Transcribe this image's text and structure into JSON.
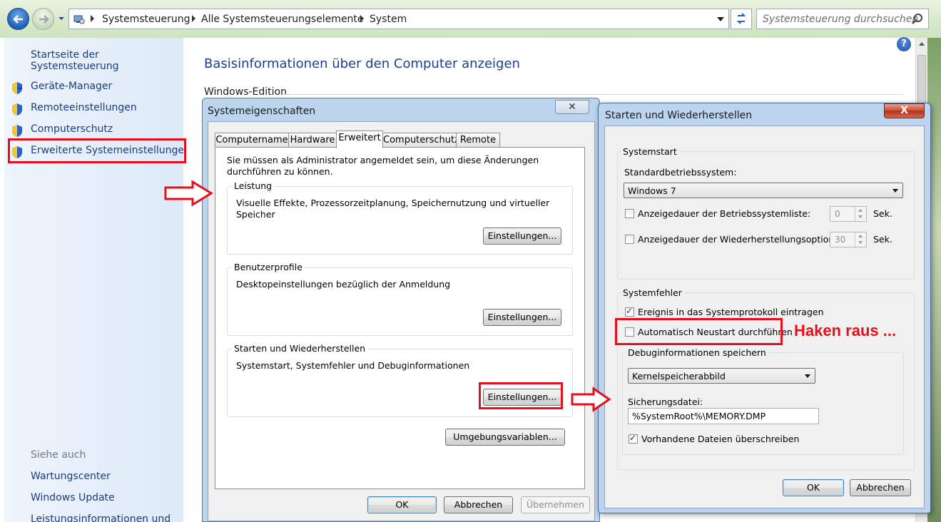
{
  "address_bar": {
    "breadcrumbs": [
      "Systemsteuerung",
      "Alle Systemsteuerungselemente",
      "System"
    ],
    "search_placeholder": "Systemsteuerung durchsuchen"
  },
  "left_pane": {
    "home_link": "Startseite der Systemsteuerung",
    "tasks": [
      {
        "label": "Geräte-Manager",
        "icon": "uac-shield-icon"
      },
      {
        "label": "Remoteeinstellungen",
        "icon": "uac-shield-icon"
      },
      {
        "label": "Computerschutz",
        "icon": "uac-shield-icon"
      },
      {
        "label": "Erweiterte Systemeinstellungen",
        "icon": "uac-shield-icon",
        "highlighted": true
      }
    ],
    "see_also_heading": "Siehe auch",
    "see_also": [
      "Wartungscenter",
      "Windows Update",
      "Leistungsinformationen und"
    ]
  },
  "main": {
    "title": "Basisinformationen über den Computer anzeigen",
    "section": "Windows-Edition",
    "help_label": "?"
  },
  "system_properties": {
    "title": "Systemeigenschaften",
    "close_label": "✕",
    "tabs": [
      "Computername",
      "Hardware",
      "Erweitert",
      "Computerschutz",
      "Remote"
    ],
    "active_tab": "Erweitert",
    "admin_note": "Sie müssen als Administrator angemeldet sein, um diese Änderungen durchführen zu können.",
    "groups": [
      {
        "label": "Leistung",
        "text": "Visuelle Effekte, Prozessorzeitplanung, Speichernutzung und virtueller Speicher",
        "button": "Einstellungen..."
      },
      {
        "label": "Benutzerprofile",
        "text": "Desktopeinstellungen bezüglich der Anmeldung",
        "button": "Einstellungen..."
      },
      {
        "label": "Starten und Wiederherstellen",
        "text": "Systemstart, Systemfehler und Debuginformationen",
        "button": "Einstellungen..."
      }
    ],
    "env_button": "Umgebungsvariablen...",
    "ok": "OK",
    "cancel": "Abbrechen",
    "apply": "Übernehmen"
  },
  "startup_recovery": {
    "title": "Starten und Wiederherstellen",
    "close_label": "X",
    "systemstart": {
      "label": "Systemstart",
      "default_os_label": "Standardbetriebssystem:",
      "default_os_value": "Windows 7",
      "os_list_label": "Anzeigedauer der Betriebssystemliste:",
      "os_list_value": "0",
      "os_list_checked": false,
      "recovery_label": "Anzeigedauer der Wiederherstellungsoptionen:",
      "recovery_value": "30",
      "recovery_checked": false,
      "unit": "Sek."
    },
    "systemfehler": {
      "label": "Systemfehler",
      "log_event_label": "Ereignis in das Systemprotokoll eintragen",
      "log_event_checked": true,
      "auto_restart_label": "Automatisch Neustart durchführen",
      "auto_restart_checked": false,
      "debug_label": "Debuginformationen speichern",
      "debug_value": "Kernelspeicherabbild",
      "dump_file_label": "Sicherungsdatei:",
      "dump_file_value": "%SystemRoot%\\MEMORY.DMP",
      "overwrite_label": "Vorhandene Dateien überschreiben",
      "overwrite_checked": true
    },
    "ok": "OK",
    "cancel": "Abbrechen"
  },
  "annotation": {
    "note": "Haken raus ...",
    "color": "#e30f1c"
  }
}
